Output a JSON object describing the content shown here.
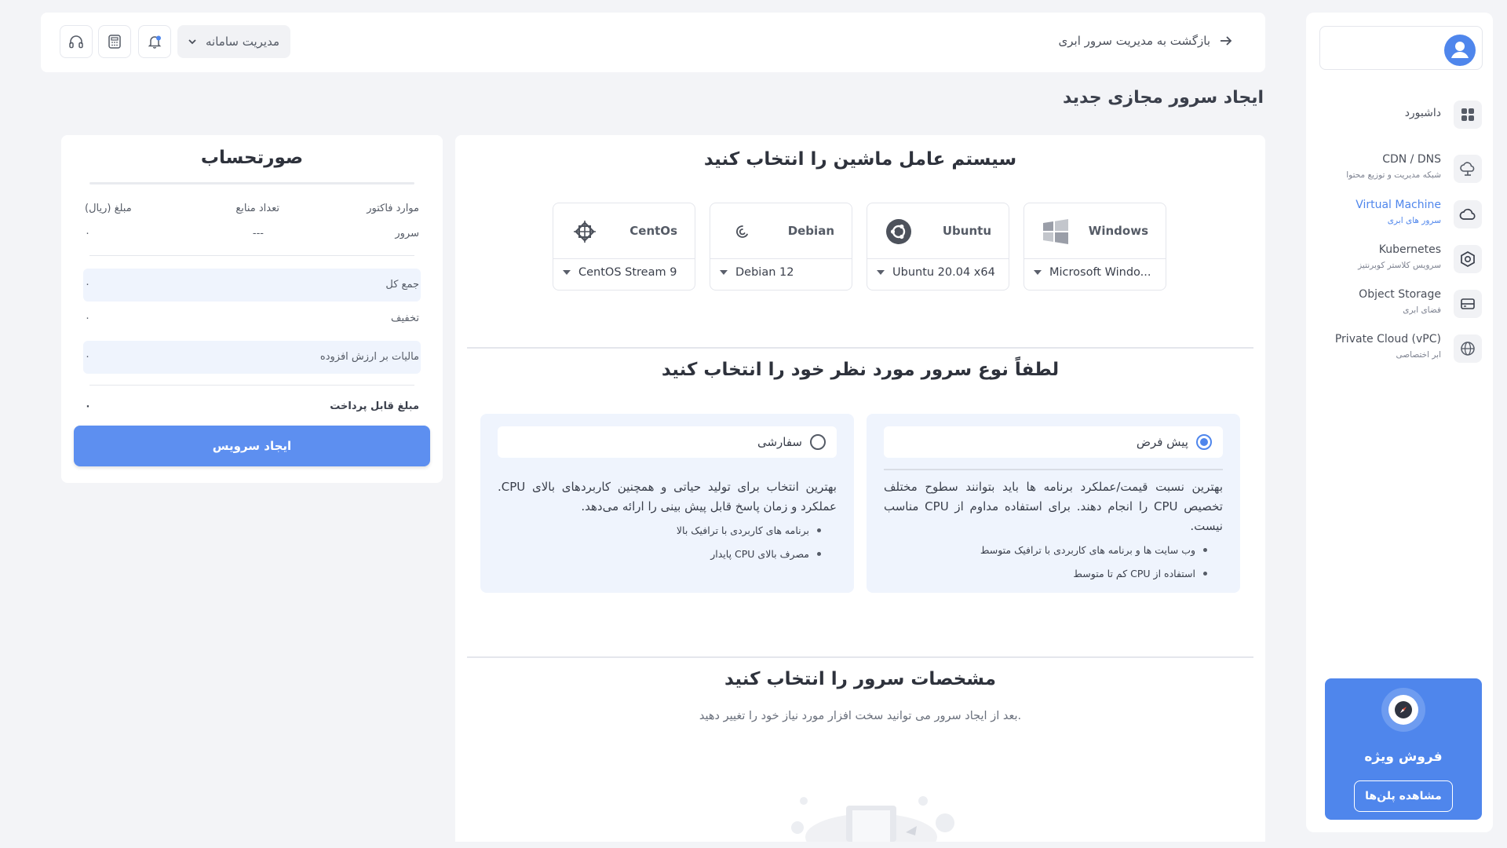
{
  "header": {
    "back_label": "بازگشت به مدیریت سرور ابری",
    "system_management_label": "مدیریت سامانه"
  },
  "page_title": "ایجاد سرور مجازی جدید",
  "sidebar": {
    "items": [
      {
        "title": "داشبورد",
        "subtitle": "",
        "icon": "dashboard-icon"
      },
      {
        "title": "CDN / DNS",
        "subtitle": "شبکه مدیریت و توزیع محتوا",
        "icon": "cdn-cloud-icon"
      },
      {
        "title": "Virtual Machine",
        "subtitle": "سرور های ابری",
        "icon": "cloud-icon",
        "active": true
      },
      {
        "title": "Kubernetes",
        "subtitle": "سرویس کلاستر کوبرنتیز",
        "icon": "kubernetes-hexagon-icon"
      },
      {
        "title": "Object Storage",
        "subtitle": "فضای ابری",
        "icon": "storage-icon"
      },
      {
        "title": "Private Cloud (vPC)",
        "subtitle": "ابر اختصاصی",
        "icon": "globe-icon"
      }
    ],
    "promo": {
      "title": "فروش ویژه",
      "button_label": "مشاهده پلن‌ها"
    }
  },
  "os_section": {
    "title": "سیستم عامل ماشین را انتخاب کنید",
    "options": [
      {
        "name": "Windows",
        "selected_version": "Microsoft Windo...",
        "icon": "windows-logo-icon"
      },
      {
        "name": "Ubuntu",
        "selected_version": "Ubuntu 20.04 x64",
        "icon": "ubuntu-logo-icon"
      },
      {
        "name": "Debian",
        "selected_version": "Debian 12",
        "icon": "debian-logo-icon"
      },
      {
        "name": "CentOs",
        "selected_version": "CentOS Stream 9",
        "icon": "centos-logo-icon"
      }
    ]
  },
  "server_type_section": {
    "title": "لطفاً نوع سرور مورد نظر خود را انتخاب کنید",
    "default_type": {
      "label": "پیش فرض",
      "selected": true,
      "description": "بهترین نسبت قیمت/عملکرد برنامه ها باید بتوانند سطوح مختلف تخصیص CPU را انجام دهند. برای استفاده مداوم از CPU مناسب نیست.",
      "bullets": [
        "وب سایت ها و برنامه های کاربردی با ترافیک متوسط",
        "استفاده از CPU کم تا متوسط"
      ]
    },
    "custom_type": {
      "label": "سفارشی",
      "selected": false,
      "description": "بهترین انتخاب برای تولید حیاتی و همچنین کاربردهای بالای CPU. عملکرد و زمان پاسخ قابل پیش بینی را ارائه می‌دهد.",
      "bullets": [
        "برنامه های کاربردی با ترافیک بالا",
        "مصرف بالای CPU پایدار"
      ]
    }
  },
  "specs_section": {
    "title": "مشخصات سرور را انتخاب کنید",
    "subtitle": "بعد از ایجاد سرور می توانید سخت افزار مورد نیاز خود را تغییر دهید."
  },
  "invoice": {
    "title": "صورتحساب",
    "col_items": "موارد فاکتور",
    "col_count": "تعداد منابع",
    "col_amount": "مبلغ (ریال)",
    "server_label": "سرور",
    "server_count": "---",
    "server_amount": "۰",
    "total_label": "جمع کل",
    "total_value": "۰",
    "discount_label": "تخفیف",
    "discount_value": "۰",
    "vat_label": "مالیات بر ارزش افزوده",
    "vat_value": "۰",
    "payable_label": "مبلغ قابل پرداخت",
    "payable_value": "۰",
    "create_button": "ایجاد سرویس"
  }
}
